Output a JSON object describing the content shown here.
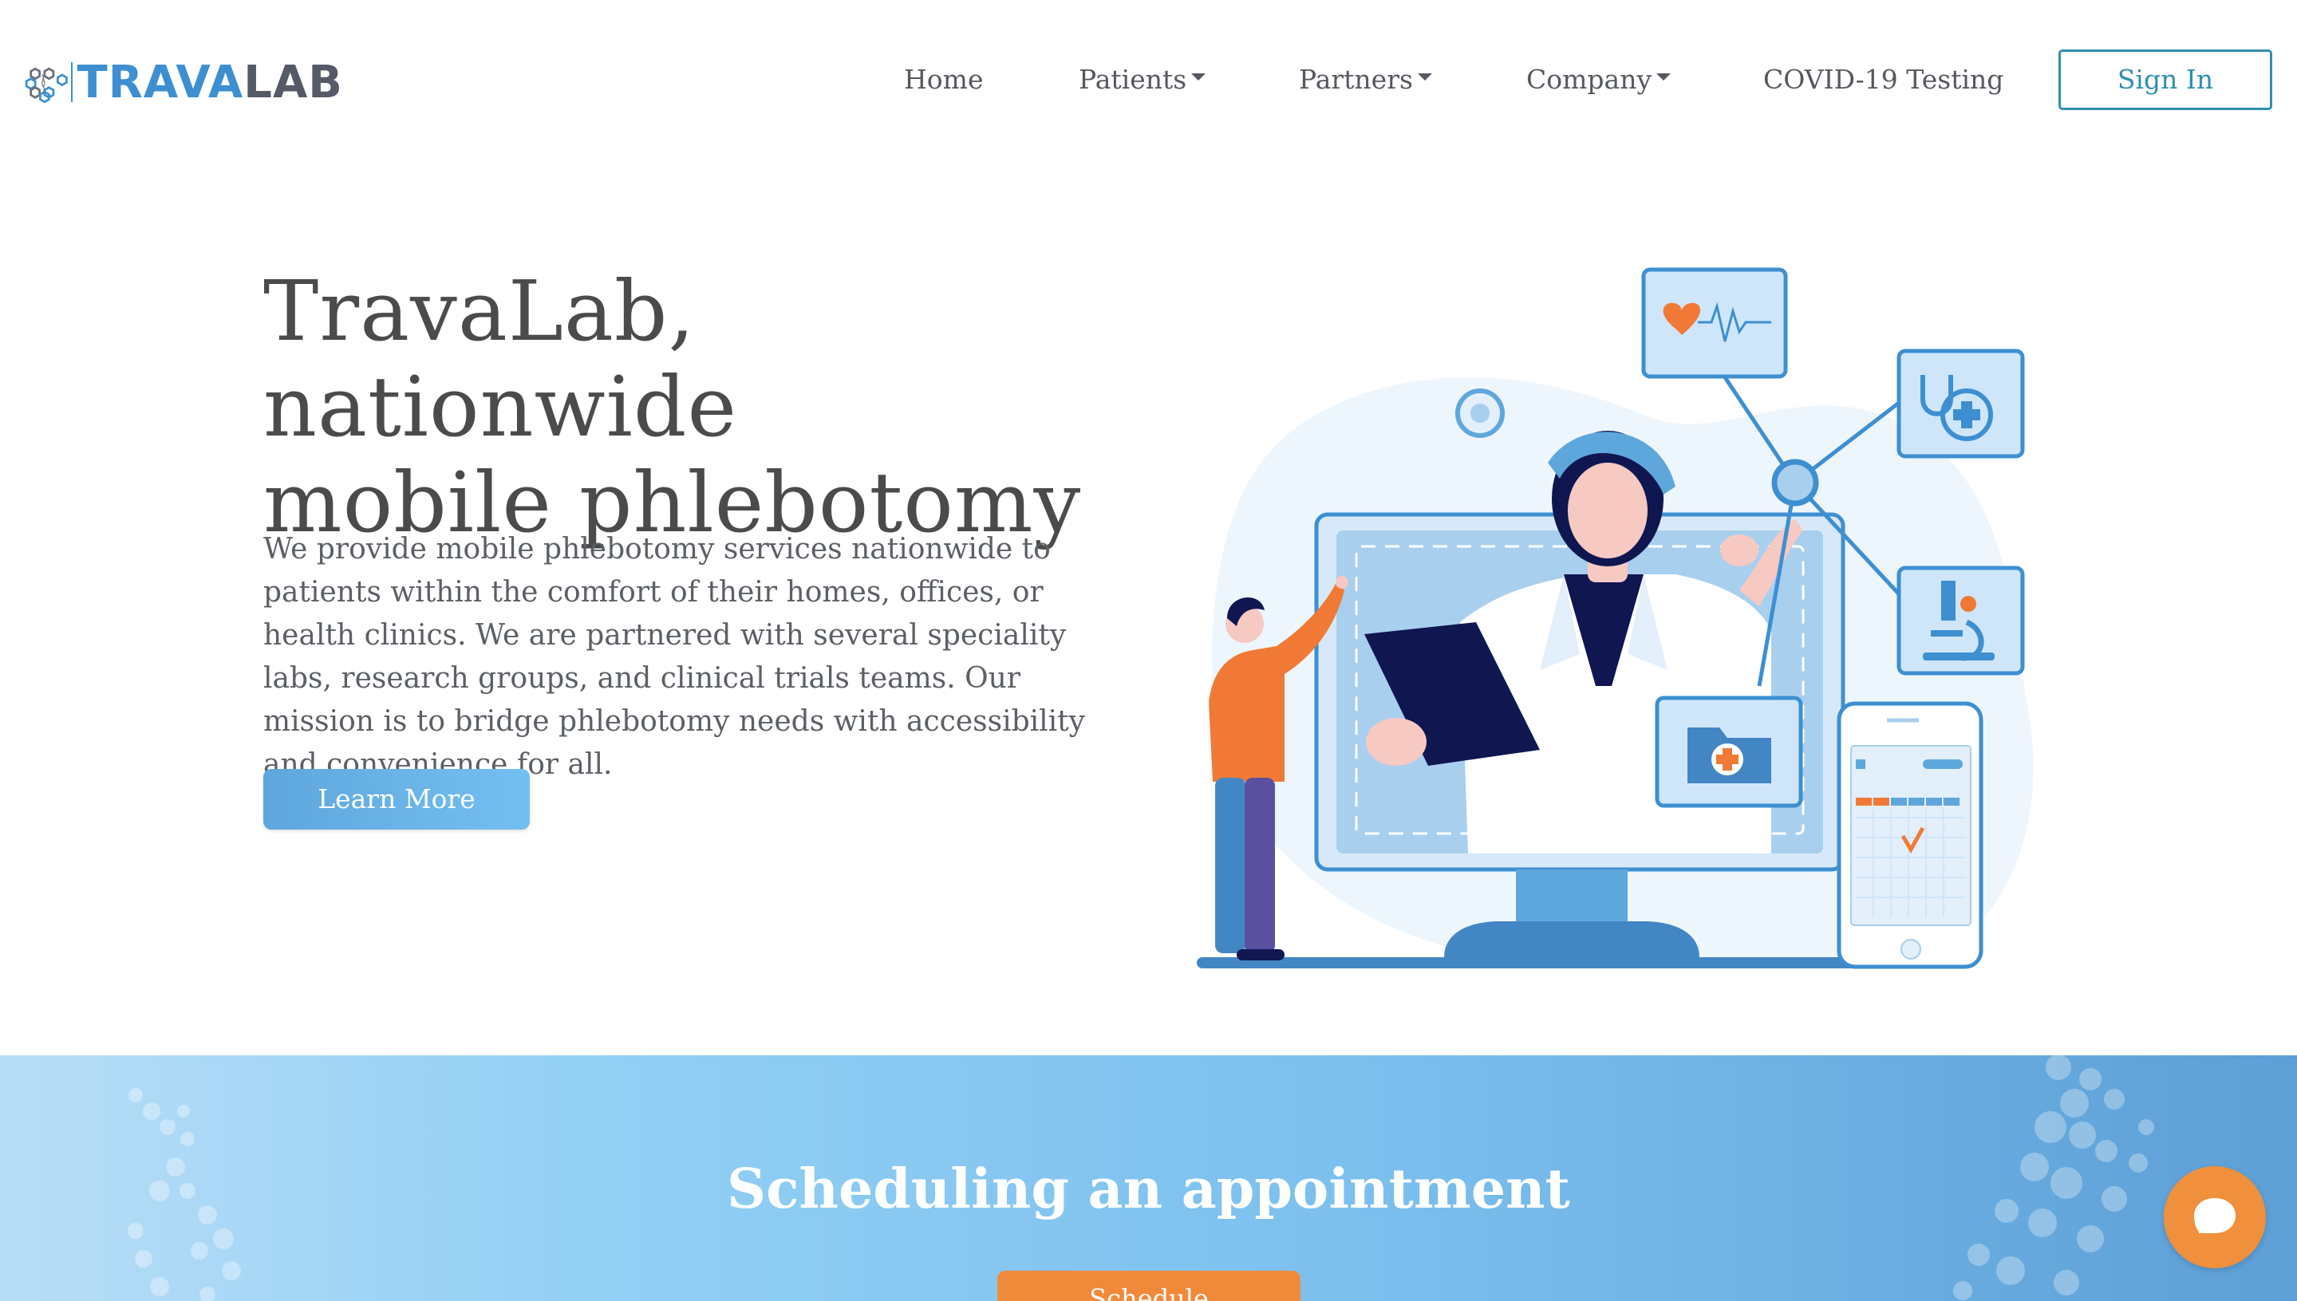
{
  "nav": {
    "logo_left": "TRAVA",
    "logo_right": "LAB",
    "items": [
      {
        "label": "Home",
        "dropdown": false
      },
      {
        "label": "Patients",
        "dropdown": true
      },
      {
        "label": "Partners",
        "dropdown": true
      },
      {
        "label": "Company",
        "dropdown": true
      },
      {
        "label": "COVID-19 Testing",
        "dropdown": false
      }
    ],
    "signin_label": "Sign In"
  },
  "hero": {
    "title_line1": "TravaLab, nationwide",
    "title_line2": "mobile phlebotomy",
    "description": "We provide mobile phlebotomy services nationwide to patients within the comfort of their homes, offices, or health clinics. We are partnered with several speciality labs, research groups, and clinical trials teams. Our mission is to bridge phlebotomy needs with accessibility and convenience for all.",
    "learn_more_label": "Learn More"
  },
  "schedule": {
    "title": "Scheduling an appointment",
    "button_label": "Schedule"
  },
  "colors": {
    "brand_blue": "#3d8fd1",
    "accent_orange": "#f08a3a",
    "signin_teal": "#2f8fb0"
  },
  "icons": [
    "logo-hexagon-icon",
    "heart-rate-icon",
    "stethoscope-icon",
    "microscope-icon",
    "medical-folder-icon",
    "chat-bubble-icon"
  ]
}
